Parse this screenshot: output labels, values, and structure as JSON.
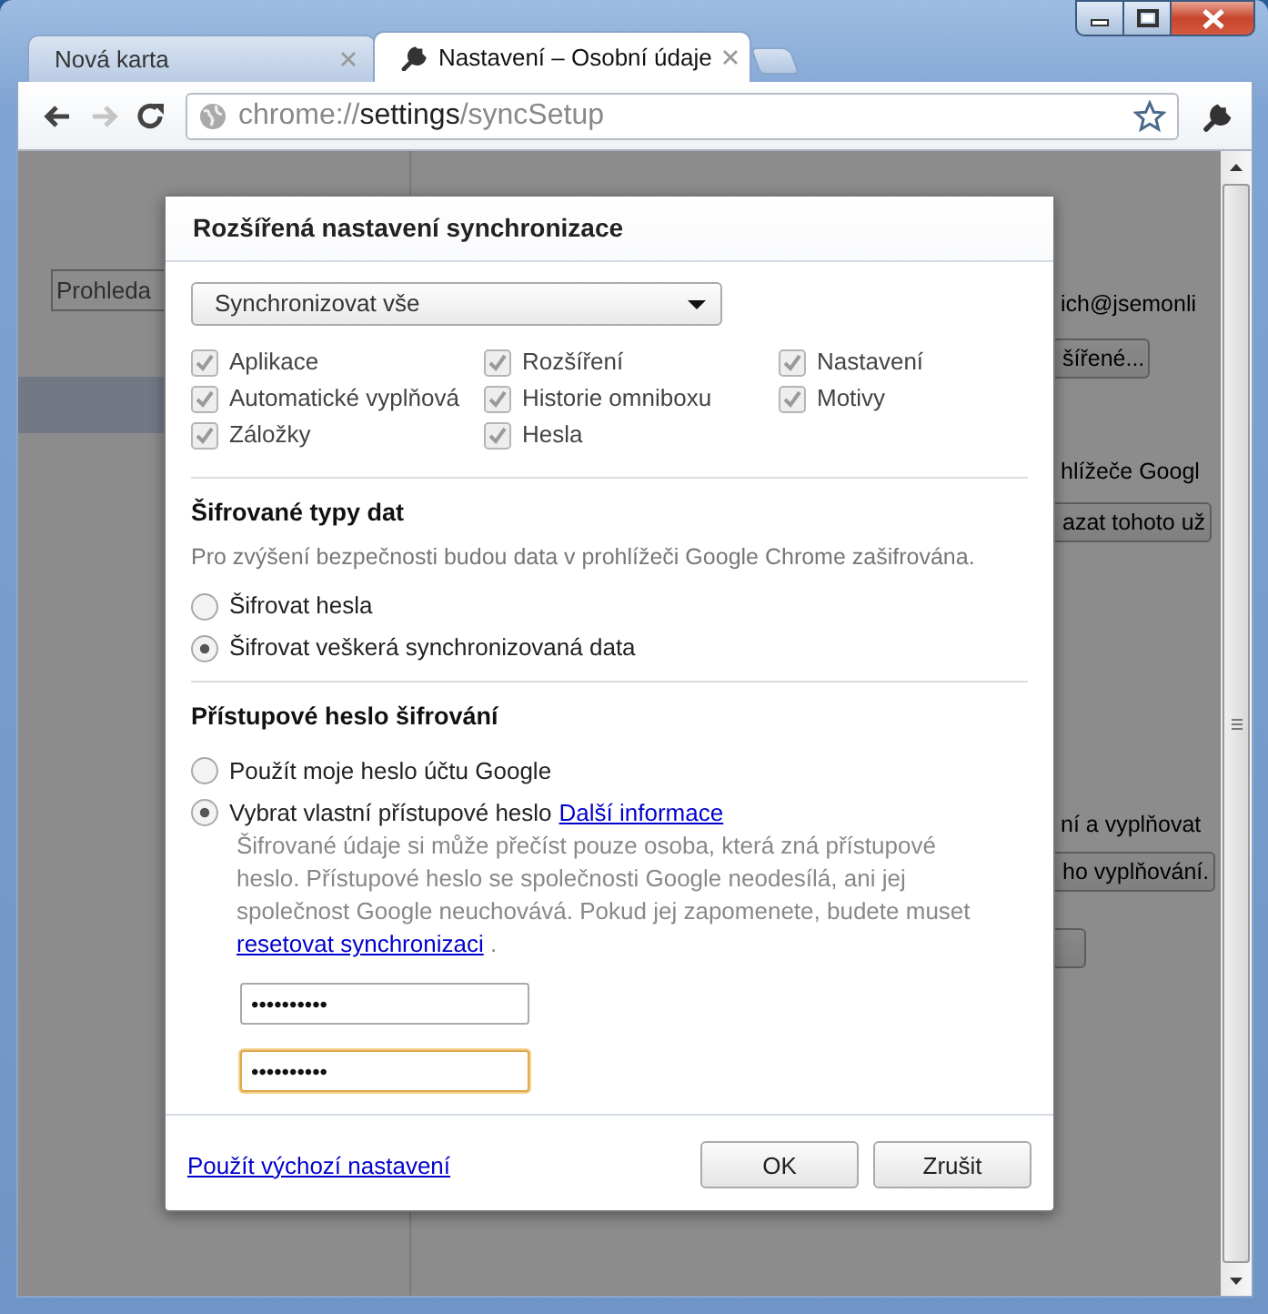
{
  "tabs": [
    {
      "label": "Nová karta",
      "selected": false
    },
    {
      "label": "Nastavení – Osobní údaje",
      "selected": true
    }
  ],
  "toolbar": {
    "back_disabled": false,
    "forward_disabled": true,
    "address": {
      "scheme": "chrome://",
      "host": "settings",
      "path": "/syncSetup"
    }
  },
  "background_page": {
    "search_placeholder": "Prohleda",
    "fragments": [
      {
        "kind": "text",
        "text": "ich@jsemonli"
      },
      {
        "kind": "button",
        "text": "šířené..."
      },
      {
        "kind": "text",
        "text": "hlížeče Googl"
      },
      {
        "kind": "button",
        "text": "azat tohoto už"
      },
      {
        "kind": "text",
        "text": "ní a vyplňovat"
      },
      {
        "kind": "button",
        "text": "ho vyplňování."
      },
      {
        "kind": "button"
      }
    ]
  },
  "dialog": {
    "title": "Rozšířená nastavení synchronizace",
    "sync_select": {
      "value": "Synchronizovat vše"
    },
    "sync_items": [
      {
        "label": "Aplikace",
        "checked": true,
        "disabled": true
      },
      {
        "label": "Rozšíření",
        "checked": true,
        "disabled": true
      },
      {
        "label": "Nastavení",
        "checked": true,
        "disabled": true
      },
      {
        "label": "Automatické vyplňová",
        "checked": true,
        "disabled": true
      },
      {
        "label": "Historie omniboxu",
        "checked": true,
        "disabled": true
      },
      {
        "label": "Motivy",
        "checked": true,
        "disabled": true
      },
      {
        "label": "Záložky",
        "checked": true,
        "disabled": true
      },
      {
        "label": "Hesla",
        "checked": true,
        "disabled": true
      }
    ],
    "encryption": {
      "heading": "Šifrované typy dat",
      "description": "Pro zvýšení bezpečnosti budou data v prohlížeči Google Chrome zašifrována.",
      "options": [
        {
          "label": "Šifrovat hesla",
          "selected": false
        },
        {
          "label": "Šifrovat veškerá synchronizovaná data",
          "selected": true
        }
      ]
    },
    "passphrase": {
      "heading": "Přístupové heslo šifrování",
      "options": [
        {
          "label": "Použít moje heslo účtu Google",
          "selected": false
        },
        {
          "label": "Vybrat vlastní přístupové heslo",
          "link": "Další informace",
          "selected": true
        }
      ],
      "note": "Šifrované údaje si může přečíst pouze osoba, která zná přístupové heslo. Přístupové heslo se společnosti Google neodesílá, ani jej společnost Google neuchovává. Pokud jej zapomenete, budete muset",
      "note_link": "resetovat synchronizaci",
      "note_end": ".",
      "fields": [
        {
          "value": "••••••••••",
          "focused": false
        },
        {
          "value": "••••••••••",
          "focused": true
        }
      ]
    },
    "footer_link": "Použít výchozí nastavení",
    "buttons": [
      "OK",
      "Zrušit"
    ]
  }
}
